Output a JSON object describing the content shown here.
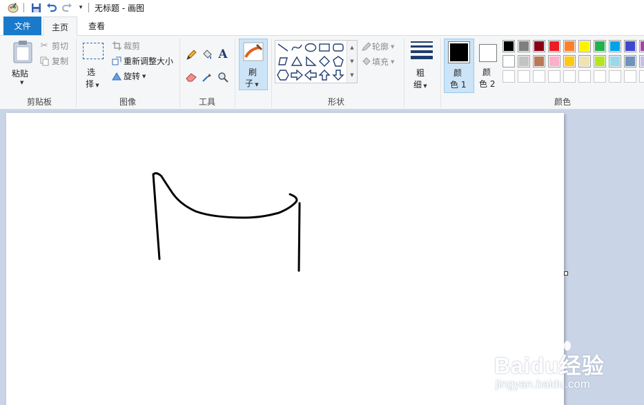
{
  "window": {
    "title": "无标题 - 画图"
  },
  "tabs": {
    "file": "文件",
    "home": "主页",
    "view": "查看"
  },
  "clipboard": {
    "paste": "粘贴",
    "cut": "剪切",
    "copy": "复制",
    "group": "剪贴板"
  },
  "image": {
    "select_line1": "选",
    "select_line2": "择",
    "crop": "裁剪",
    "resize": "重新调整大小",
    "rotate": "旋转",
    "group": "图像"
  },
  "tools": {
    "group": "工具"
  },
  "brushes": {
    "line1": "刷",
    "line2": "子"
  },
  "shapes": {
    "outline": "轮廓",
    "fill": "填充",
    "group": "形状"
  },
  "size": {
    "line1": "粗",
    "line2": "细"
  },
  "colors": {
    "color1_line1": "颜",
    "color1_line2": "色 1",
    "color2_line1": "颜",
    "color2_line2": "色 2",
    "group": "颜色",
    "color1_value": "#000000",
    "color2_value": "#ffffff",
    "palette_row1": [
      "#000000",
      "#7f7f7f",
      "#880015",
      "#ed1c24",
      "#ff7f27",
      "#fff200",
      "#22b14c",
      "#00a2e8",
      "#3f48cc",
      "#a349a4"
    ],
    "palette_row2": [
      "#ffffff",
      "#c3c3c3",
      "#b97a57",
      "#ffaec9",
      "#ffc90e",
      "#efe4b0",
      "#b5e61d",
      "#99d9ea",
      "#7092be",
      "#c8bfe7"
    ]
  },
  "watermark": {
    "brand": "Baidu经验",
    "url": "jingyan.baidu.com"
  }
}
